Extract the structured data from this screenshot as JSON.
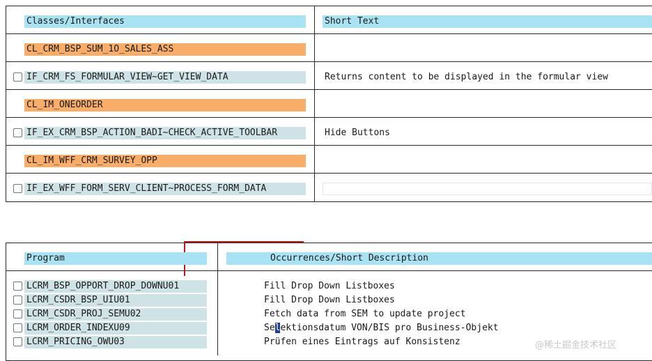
{
  "classes_table": {
    "header_classes": "Classes/Interfaces",
    "header_short_text": "Short Text",
    "rows": [
      {
        "kind": "class",
        "name": "CL_CRM_BSP_SUM_1O_SALES_ASS",
        "text": ""
      },
      {
        "kind": "method",
        "name": "IF_CRM_FS_FORMULAR_VIEW~GET_VIEW_DATA",
        "text": "Returns content to be displayed in the formular view"
      },
      {
        "kind": "class",
        "name": "CL_IM_ONEORDER",
        "text": ""
      },
      {
        "kind": "method",
        "name": "IF_EX_CRM_BSP_ACTION_BADI~CHECK_ACTIVE_TOOLBAR",
        "text": "Hide Buttons"
      },
      {
        "kind": "class",
        "name": "CL_IM_WFF_CRM_SURVEY_OPP",
        "text": ""
      },
      {
        "kind": "method",
        "name": "IF_EX_WFF_FORM_SERV_CLIENT~PROCESS_FORM_DATA",
        "text": ""
      }
    ]
  },
  "programs_table": {
    "header_program": "Program",
    "header_occurrences": "Occurrences/Short Description",
    "rows": [
      {
        "program": "LCRM_BSP_OPPORT_DROP_DOWNU01",
        "description": "Fill Drop Down Listboxes"
      },
      {
        "program": "LCRM_CSDR_BSP_UIU01",
        "description": "Fill Drop Down Listboxes"
      },
      {
        "program": "LCRM_CSDR_PROJ_SEMU02",
        "description": "Fetch data from SEM to update project"
      },
      {
        "program": "LCRM_ORDER_INDEXU09",
        "description_before_cursor": "Se",
        "description_cursor_char": "l",
        "description_after_cursor": "ektionsdatum VON/BIS pro Business-Objekt"
      },
      {
        "program": "LCRM_PRICING_OWU03",
        "description": "Prüfen eines Eintrags auf Konsistenz"
      }
    ]
  },
  "watermark": "@稀土掘金技术社区",
  "colors": {
    "header_bg": "#a9e2f2",
    "class_bg": "#f8ae69",
    "method_bg": "#cfe3e7",
    "cursor_bg": "#1f3f8f",
    "annotation_red": "#b21c1c"
  }
}
